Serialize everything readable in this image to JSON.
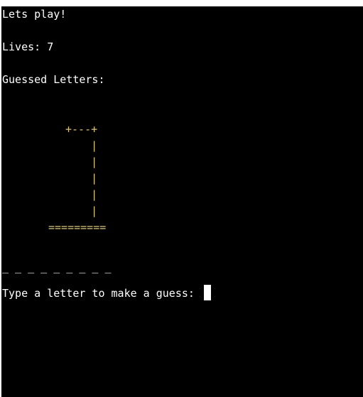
{
  "header": {
    "title": "Lets play!",
    "lives_text": "Lives: 7",
    "guessed_label": "Guessed Letters:"
  },
  "hangman": {
    "art": [
      "+---+",
      "    |",
      "    |",
      "    |",
      "    |",
      "    |",
      "========="
    ]
  },
  "word": {
    "display": "_ _ _ _ _ _ _ _ _"
  },
  "prompt": {
    "text": "Type a letter to make a guess: "
  },
  "colors": {
    "background": "#000000",
    "text": "#ffffff",
    "gallows": "#d9c47a"
  }
}
